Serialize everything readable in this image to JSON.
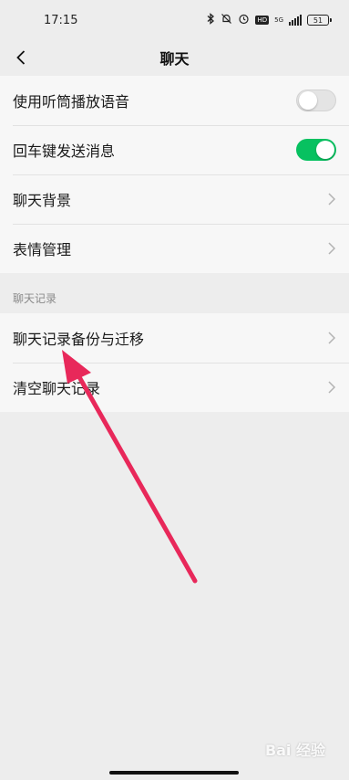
{
  "status_bar": {
    "time": "17:15",
    "network": "5G",
    "hd": "HD",
    "battery": "51"
  },
  "nav": {
    "back_icon": "chevron-left-icon",
    "title": "聊天"
  },
  "settings": [
    {
      "label": "使用听筒播放语音",
      "control": "switch",
      "checked": false
    },
    {
      "label": "回车键发送消息",
      "control": "switch",
      "checked": true
    },
    {
      "label": "聊天背景",
      "control": "chevron"
    },
    {
      "label": "表情管理",
      "control": "chevron"
    }
  ],
  "chat_history": {
    "header": "聊天记录",
    "items": [
      {
        "label": "聊天记录备份与迁移"
      },
      {
        "label": "清空聊天记录"
      }
    ]
  },
  "colors": {
    "switch_on": "#07c160",
    "switch_off": "#e4e4e4",
    "annotation_arrow": "#e8285a"
  },
  "watermark": {
    "text": "Bai  经验"
  }
}
